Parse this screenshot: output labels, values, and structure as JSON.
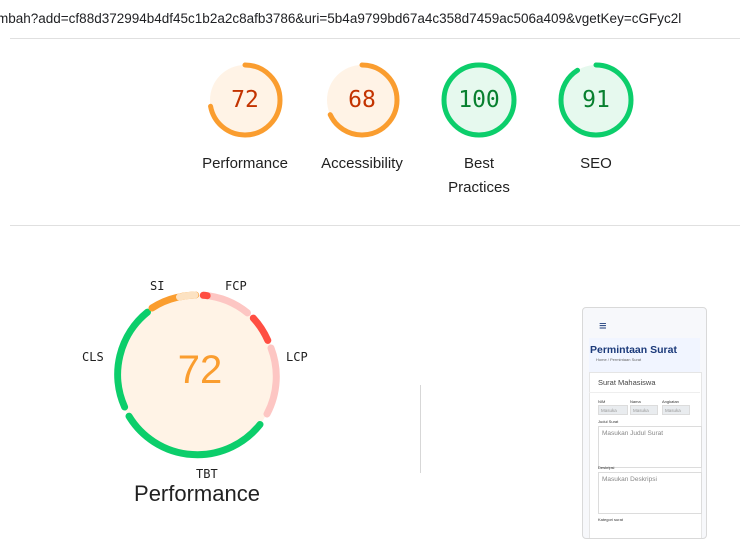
{
  "url_text": "mbah?add=cf88d372994b4df45c1b2a2c8afb3786&uri=5b4a9799bd67a4c358d7459ac506a409&vgetKey=cGFyc2l",
  "gauges": [
    {
      "score": "72",
      "label": "Performance",
      "value": 0.72,
      "color": "#fa9d2f",
      "bg": "#fff3e6",
      "text_color": "#c33300"
    },
    {
      "score": "68",
      "label": "Accessibility",
      "value": 0.68,
      "color": "#fa9d2f",
      "bg": "#fff3e6",
      "text_color": "#c33300"
    },
    {
      "score": "100",
      "label": "Best Practices",
      "value": 1.0,
      "color": "#0cce6b",
      "bg": "#e6f9ee",
      "text_color": "#08802f"
    },
    {
      "score": "91",
      "label": "SEO",
      "value": 0.91,
      "color": "#0cce6b",
      "bg": "#e6f9ee",
      "text_color": "#08802f"
    }
  ],
  "performance": {
    "score": "72",
    "title": "Performance",
    "metrics": {
      "si": "SI",
      "fcp": "FCP",
      "lcp": "LCP",
      "tbt": "TBT",
      "cls": "CLS"
    },
    "colors": {
      "good": "#0cce6b",
      "average": "#fa9d2f",
      "poor": "#ff4e42",
      "score_bg": "#fff3e6"
    }
  },
  "screenshot": {
    "menu_icon": "hamburger-icon",
    "title": "Permintaan Surat",
    "breadcrumb": "Home / Permintaan Surat",
    "card_title": "Surat Mahasiswa",
    "col_nim": "NIM",
    "col_nama": "Nama",
    "col_angkatan": "Angkatan",
    "placeholder_masuk": "Masuka",
    "label_judul": "Judul Surat",
    "placeholder_judul": "Masukan Judul Surat",
    "label_deskripsi": "Deskripsi",
    "placeholder_deskripsi": "Masukan Deskripsi",
    "label_kategori": "Kategori surat"
  }
}
